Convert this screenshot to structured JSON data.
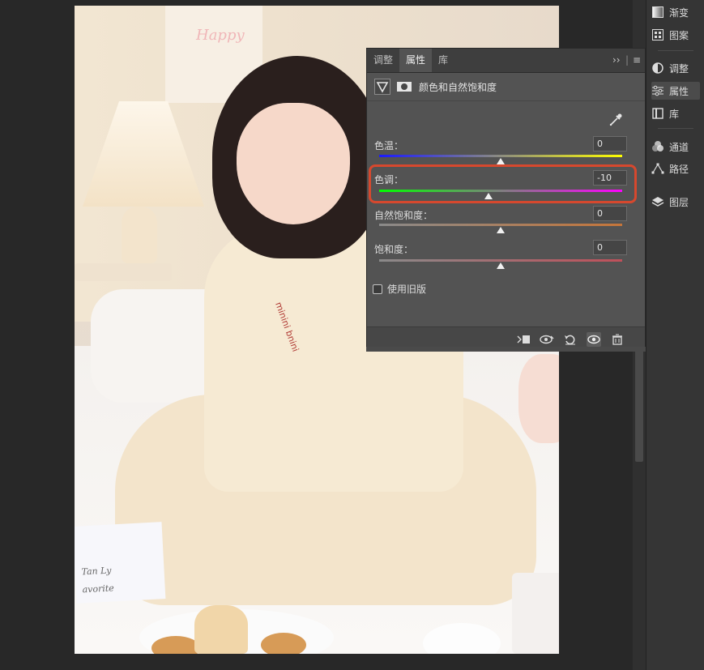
{
  "right_dock": {
    "items": [
      {
        "label": "渐变",
        "icon": "gradient-icon"
      },
      {
        "label": "图案",
        "icon": "pattern-icon"
      },
      {
        "label": "调整",
        "icon": "adjustments-icon"
      },
      {
        "label": "属性",
        "icon": "properties-icon"
      },
      {
        "label": "库",
        "icon": "libraries-icon"
      },
      {
        "label": "通道",
        "icon": "channels-icon"
      },
      {
        "label": "路径",
        "icon": "paths-icon"
      },
      {
        "label": "图层",
        "icon": "layers-icon"
      }
    ],
    "active": "属性"
  },
  "panel": {
    "tabs": [
      "调整",
      "属性",
      "库"
    ],
    "active_tab": "属性",
    "collapse_glyph": "››",
    "menu_glyph": "≡",
    "header_title": "颜色和自然饱和度",
    "controls": [
      {
        "label": "色温：",
        "value": "0",
        "gradient": [
          "#1a1aff",
          "#ffff00"
        ],
        "position_percent": 50
      },
      {
        "label": "色调：",
        "value": "-10",
        "gradient": [
          "#00ff00",
          "#ff00ff"
        ],
        "position_percent": 45
      },
      {
        "label": "自然饱和度：",
        "value": "0",
        "gradient": [
          "#8a8a8a",
          "#c6763a"
        ],
        "position_percent": 50
      },
      {
        "label": "饱和度：",
        "value": "0",
        "gradient": [
          "#8a8a8a",
          "#c0505a"
        ],
        "position_percent": 50
      }
    ],
    "legacy_label": "使用旧版",
    "legacy_checked": false,
    "bottom_icons": [
      "clip-to-layer-icon",
      "view-previous-state-icon",
      "reset-icon",
      "visibility-eye-icon",
      "delete-icon"
    ]
  },
  "canvas": {
    "poster_text": "Happy",
    "book_text_1": "Tan Ly",
    "book_text_2": "avorite",
    "shirt_text": "minini bnini"
  },
  "colors": {
    "app_bg": "#282828",
    "panel_bg": "#535353",
    "highlight": "#d6482e"
  }
}
